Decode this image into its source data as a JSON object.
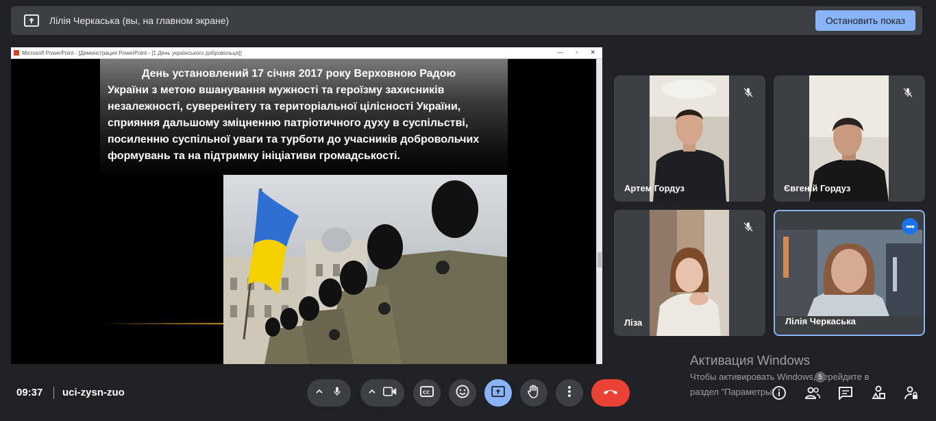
{
  "header": {
    "presenter_title": "Лілія Черкаська (вы, на главном экране)",
    "stop_button": "Остановить показ"
  },
  "shared_screen": {
    "window_title": "Microsoft PowerPoint - [Демонстрация PowerPoint - [1 День українського добровольця]]",
    "slide_text": "День установлений 17 січня 2017 року Верховною Радою України з метою вшанування мужності та героїзму захисників незалежності, суверенітету та територіальної цілісності України, сприяння дальшому зміцненню патріотичного духу в суспільстві, посиленню суспільної уваги та турботи до учасників добровольчих формувань та на підтримку ініціативи громадськості."
  },
  "participants": [
    {
      "name": "Артем Гордуз",
      "muted": true
    },
    {
      "name": "Євгеній Гордуз",
      "muted": true
    },
    {
      "name": "Ліза",
      "muted": true
    },
    {
      "name": "Лілія Черкаська",
      "muted": false,
      "active": true
    }
  ],
  "watermark": {
    "title": "Активация Windows",
    "line1": "Чтобы активировать Windows, перейдите в",
    "line2": "раздел \"Параметры\"."
  },
  "footer": {
    "time": "09:37",
    "meeting_code": "uci-zysn-zuo",
    "people_count": "5"
  },
  "colors": {
    "accent": "#8ab4f8",
    "end_call": "#ea4335",
    "surface": "#3c4043",
    "background": "#202124"
  }
}
